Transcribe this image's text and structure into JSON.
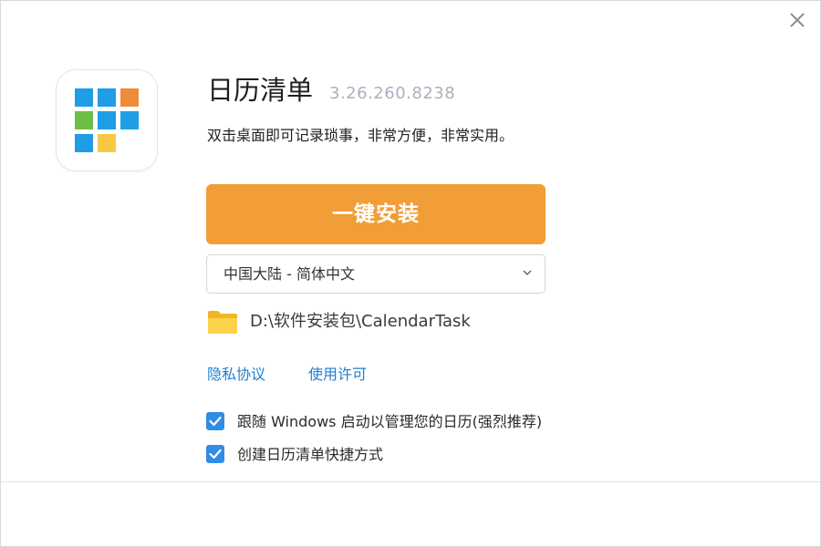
{
  "app": {
    "title": "日历清单",
    "version": "3.26.260.8238",
    "description": "双击桌面即可记录琐事，非常方便，非常实用。",
    "icon_name": "calendar-grid-logo",
    "icon_colors": {
      "blue": "#1f9de6",
      "orange": "#ef8c3c",
      "green": "#6bbf45",
      "yellow": "#f7c843"
    }
  },
  "installer": {
    "install_label": "一键安装",
    "install_color": "#f19e38",
    "language_select": {
      "selected": "中国大陆 - 简体中文"
    },
    "install_path": "D:\\软件安装包\\CalendarTask",
    "folder_icon": "folder-icon"
  },
  "links": {
    "privacy": "隐私协议",
    "license": "使用许可",
    "color": "#1c7fd1"
  },
  "options": [
    {
      "label": "跟随 Windows 启动以管理您的日历(强烈推荐)",
      "checked": true
    },
    {
      "label": "创建日历清单快捷方式",
      "checked": true
    }
  ],
  "window": {
    "close_icon": "close-icon"
  }
}
